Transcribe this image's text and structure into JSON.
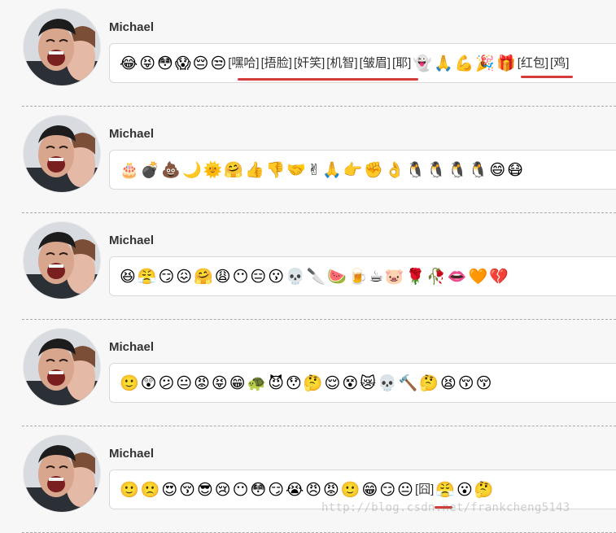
{
  "colors": {
    "page_bg": "#f7f7f7",
    "bubble_bg": "#ffffff",
    "bubble_border": "#d9d9d9",
    "name_text": "#333333",
    "underline_red": "#d43b3b",
    "divider": "#aaaaaa"
  },
  "messages": [
    {
      "author": "Michael",
      "avatar_icon": "smiling-couple-avatar",
      "content": [
        {
          "type": "emoji",
          "value": "😂"
        },
        {
          "type": "emoji",
          "value": "😝"
        },
        {
          "type": "emoji",
          "value": "😳"
        },
        {
          "type": "emoji",
          "value": "😱"
        },
        {
          "type": "emoji",
          "value": "😔"
        },
        {
          "type": "emoji",
          "value": "😒"
        },
        {
          "type": "tag",
          "value": "[嘿哈]"
        },
        {
          "type": "tag",
          "value": "[捂脸]"
        },
        {
          "type": "tag",
          "value": "[奸笑]"
        },
        {
          "type": "tag",
          "value": "[机智]"
        },
        {
          "type": "tag",
          "value": "[皱眉]"
        },
        {
          "type": "tag",
          "value": "[耶]"
        },
        {
          "type": "emoji",
          "value": "👻"
        },
        {
          "type": "emoji",
          "value": "🙏"
        },
        {
          "type": "emoji",
          "value": "💪"
        },
        {
          "type": "emoji",
          "value": "🎉"
        },
        {
          "type": "emoji",
          "value": "🎁"
        },
        {
          "type": "tag",
          "value": "[红包]"
        },
        {
          "type": "tag",
          "value": "[鸡]"
        }
      ]
    },
    {
      "author": "Michael",
      "avatar_icon": "smiling-couple-avatar",
      "content": [
        {
          "type": "emoji",
          "value": "🎂"
        },
        {
          "type": "emoji",
          "value": "💣"
        },
        {
          "type": "emoji",
          "value": "💩"
        },
        {
          "type": "emoji",
          "value": "🌙"
        },
        {
          "type": "emoji",
          "value": "🌞"
        },
        {
          "type": "emoji",
          "value": "🤗"
        },
        {
          "type": "emoji",
          "value": "👍"
        },
        {
          "type": "emoji",
          "value": "👎"
        },
        {
          "type": "emoji",
          "value": "🤝"
        },
        {
          "type": "emoji",
          "value": "✌"
        },
        {
          "type": "emoji",
          "value": "🙏"
        },
        {
          "type": "emoji",
          "value": "👉"
        },
        {
          "type": "emoji",
          "value": "✊"
        },
        {
          "type": "emoji",
          "value": "👌"
        },
        {
          "type": "emoji",
          "value": "🐧"
        },
        {
          "type": "emoji",
          "value": "🐧"
        },
        {
          "type": "emoji",
          "value": "🐧"
        },
        {
          "type": "emoji",
          "value": "🐧"
        },
        {
          "type": "emoji",
          "value": "😄"
        },
        {
          "type": "emoji",
          "value": "😷"
        }
      ]
    },
    {
      "author": "Michael",
      "avatar_icon": "smiling-couple-avatar",
      "content": [
        {
          "type": "emoji",
          "value": "😆"
        },
        {
          "type": "emoji",
          "value": "😤"
        },
        {
          "type": "emoji",
          "value": "😏"
        },
        {
          "type": "emoji",
          "value": "😖"
        },
        {
          "type": "emoji",
          "value": "🤗"
        },
        {
          "type": "emoji",
          "value": "😩"
        },
        {
          "type": "emoji",
          "value": "😶"
        },
        {
          "type": "emoji",
          "value": "😑"
        },
        {
          "type": "emoji",
          "value": "😗"
        },
        {
          "type": "emoji",
          "value": "💀"
        },
        {
          "type": "emoji",
          "value": "🔪"
        },
        {
          "type": "emoji",
          "value": "🍉"
        },
        {
          "type": "emoji",
          "value": "🍺"
        },
        {
          "type": "emoji",
          "value": "☕"
        },
        {
          "type": "emoji",
          "value": "🐷"
        },
        {
          "type": "emoji",
          "value": "🌹"
        },
        {
          "type": "emoji",
          "value": "🥀"
        },
        {
          "type": "emoji",
          "value": "👄"
        },
        {
          "type": "emoji",
          "value": "🧡"
        },
        {
          "type": "emoji",
          "value": "💔"
        }
      ]
    },
    {
      "author": "Michael",
      "avatar_icon": "smiling-couple-avatar",
      "content": [
        {
          "type": "emoji",
          "value": "🙂"
        },
        {
          "type": "emoji",
          "value": "😲"
        },
        {
          "type": "emoji",
          "value": "😕"
        },
        {
          "type": "emoji",
          "value": "😐"
        },
        {
          "type": "emoji",
          "value": "😡"
        },
        {
          "type": "emoji",
          "value": "😝"
        },
        {
          "type": "emoji",
          "value": "😁"
        },
        {
          "type": "emoji",
          "value": "🐢"
        },
        {
          "type": "emoji",
          "value": "😈"
        },
        {
          "type": "emoji",
          "value": "😯"
        },
        {
          "type": "emoji",
          "value": "🤔"
        },
        {
          "type": "emoji",
          "value": "😌"
        },
        {
          "type": "emoji",
          "value": "😵"
        },
        {
          "type": "emoji",
          "value": "😿"
        },
        {
          "type": "emoji",
          "value": "💀"
        },
        {
          "type": "emoji",
          "value": "🔨"
        },
        {
          "type": "emoji",
          "value": "🤔"
        },
        {
          "type": "emoji",
          "value": "😫"
        },
        {
          "type": "emoji",
          "value": "😚"
        },
        {
          "type": "emoji",
          "value": "😚"
        }
      ]
    },
    {
      "author": "Michael",
      "avatar_icon": "smiling-couple-avatar",
      "content": [
        {
          "type": "emoji",
          "value": "🙂"
        },
        {
          "type": "emoji",
          "value": "🙁"
        },
        {
          "type": "emoji",
          "value": "😍"
        },
        {
          "type": "emoji",
          "value": "😚"
        },
        {
          "type": "emoji",
          "value": "😎"
        },
        {
          "type": "emoji",
          "value": "😢"
        },
        {
          "type": "emoji",
          "value": "😶"
        },
        {
          "type": "emoji",
          "value": "😳"
        },
        {
          "type": "emoji",
          "value": "😏"
        },
        {
          "type": "emoji",
          "value": "😭"
        },
        {
          "type": "emoji",
          "value": "😠"
        },
        {
          "type": "emoji",
          "value": "😡"
        },
        {
          "type": "emoji",
          "value": "🙂"
        },
        {
          "type": "emoji",
          "value": "😁"
        },
        {
          "type": "emoji",
          "value": "😏"
        },
        {
          "type": "emoji",
          "value": "😐"
        },
        {
          "type": "tag",
          "value": "[囧]"
        },
        {
          "type": "emoji",
          "value": "😤"
        },
        {
          "type": "emoji",
          "value": "😮"
        },
        {
          "type": "emoji",
          "value": "🤔"
        }
      ]
    }
  ],
  "watermark": "http://blog.csdn.net/frankcheng5143"
}
